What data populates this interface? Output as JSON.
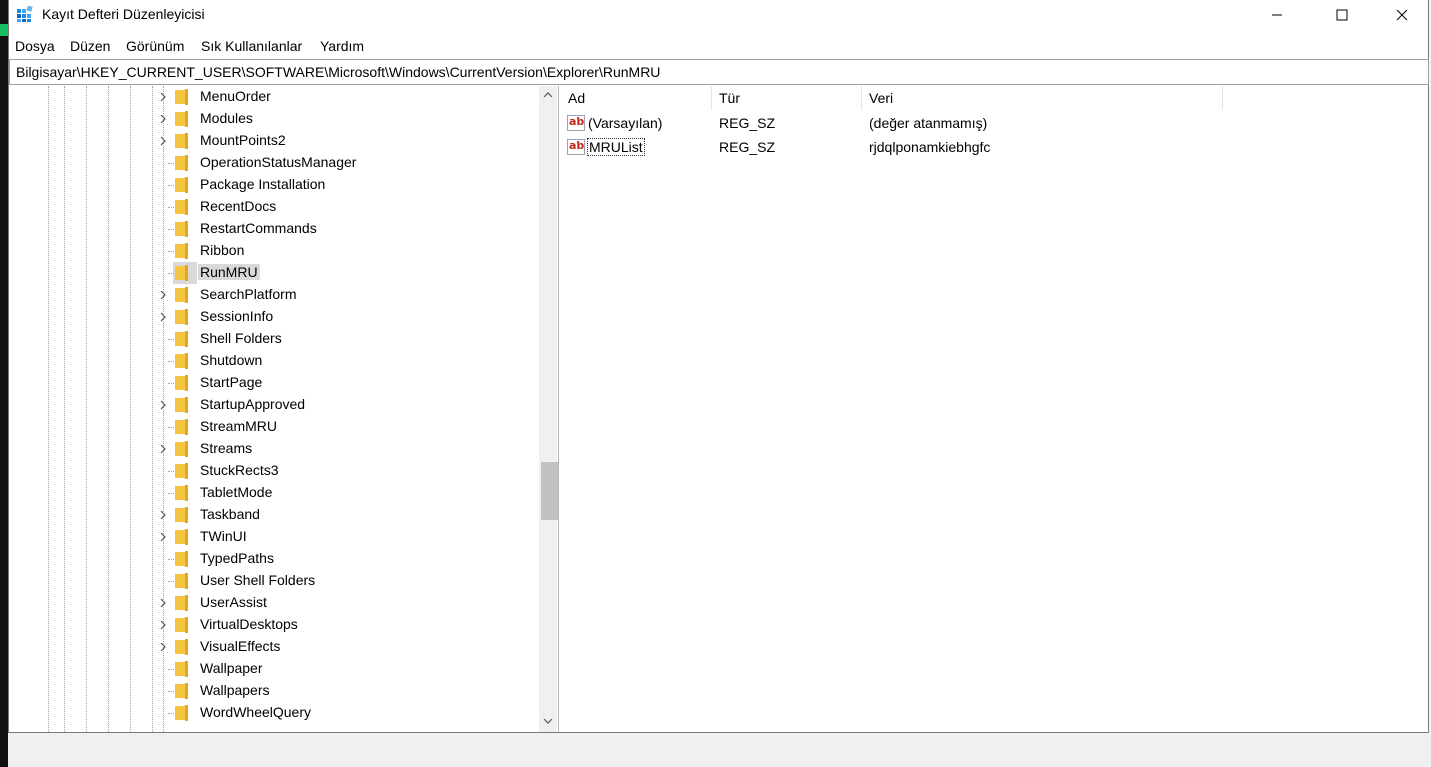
{
  "window": {
    "title": "Kayıt Defteri Düzenleyicisi",
    "controls": {
      "minimize": "minimize-icon",
      "maximize": "maximize-icon",
      "close": "close-icon"
    }
  },
  "menu": [
    "Dosya",
    "Düzen",
    "Görünüm",
    "Sık Kullanılanlar",
    "Yardım"
  ],
  "address": "Bilgisayar\\HKEY_CURRENT_USER\\SOFTWARE\\Microsoft\\Windows\\CurrentVersion\\Explorer\\RunMRU",
  "tree": {
    "items": [
      {
        "label": "MenuOrder",
        "expandable": true
      },
      {
        "label": "Modules",
        "expandable": true
      },
      {
        "label": "MountPoints2",
        "expandable": true
      },
      {
        "label": "OperationStatusManager",
        "expandable": false
      },
      {
        "label": "Package Installation",
        "expandable": false
      },
      {
        "label": "RecentDocs",
        "expandable": false
      },
      {
        "label": "RestartCommands",
        "expandable": false
      },
      {
        "label": "Ribbon",
        "expandable": false
      },
      {
        "label": "RunMRU",
        "expandable": false,
        "selected": true
      },
      {
        "label": "SearchPlatform",
        "expandable": true
      },
      {
        "label": "SessionInfo",
        "expandable": true
      },
      {
        "label": "Shell Folders",
        "expandable": false
      },
      {
        "label": "Shutdown",
        "expandable": false
      },
      {
        "label": "StartPage",
        "expandable": false
      },
      {
        "label": "StartupApproved",
        "expandable": true
      },
      {
        "label": "StreamMRU",
        "expandable": false
      },
      {
        "label": "Streams",
        "expandable": true
      },
      {
        "label": "StuckRects3",
        "expandable": false
      },
      {
        "label": "TabletMode",
        "expandable": false
      },
      {
        "label": "Taskband",
        "expandable": true
      },
      {
        "label": "TWinUI",
        "expandable": true
      },
      {
        "label": "TypedPaths",
        "expandable": false
      },
      {
        "label": "User Shell Folders",
        "expandable": false
      },
      {
        "label": "UserAssist",
        "expandable": true
      },
      {
        "label": "VirtualDesktops",
        "expandable": true
      },
      {
        "label": "VisualEffects",
        "expandable": true
      },
      {
        "label": "Wallpaper",
        "expandable": false
      },
      {
        "label": "Wallpapers",
        "expandable": false
      },
      {
        "label": "WordWheelQuery",
        "expandable": false
      }
    ]
  },
  "values": {
    "headers": {
      "name": "Ad",
      "type": "Tür",
      "data": "Veri"
    },
    "rows": [
      {
        "name": "(Varsayılan)",
        "type": "REG_SZ",
        "data": "(değer atanmamış)",
        "icon": "string-value-icon"
      },
      {
        "name": "MRUList",
        "type": "REG_SZ",
        "data": "rjdqlponamkiebhgfc",
        "icon": "string-value-icon",
        "focused": true
      }
    ]
  },
  "colors": {
    "folder": "#f5c542",
    "selection": "#d9d9d9",
    "accent": "#0078d7"
  }
}
